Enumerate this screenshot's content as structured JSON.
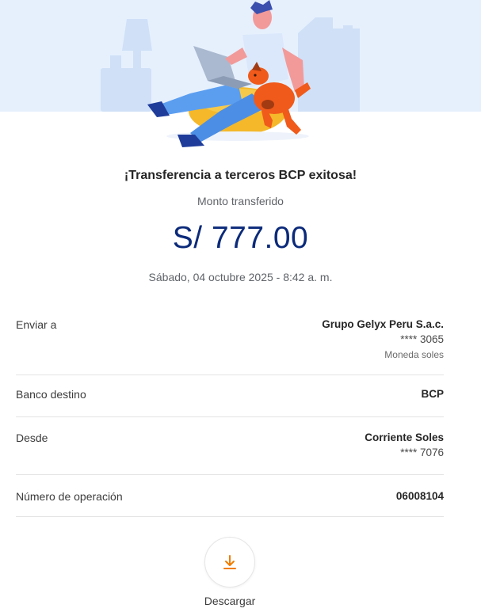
{
  "header": {
    "title": "¡Transferencia a terceros BCP exitosa!",
    "subtitle": "Monto transferido",
    "amount": "S/ 777.00",
    "date": "Sábado, 04 octubre 2025 - 8:42 a. m."
  },
  "details": {
    "recipient": {
      "label": "Enviar a",
      "name": "Grupo Gelyx Peru S.a.c.",
      "account": "**** 3065",
      "currency": "Moneda soles"
    },
    "bank": {
      "label": "Banco destino",
      "value": "BCP"
    },
    "source": {
      "label": "Desde",
      "account_type": "Corriente Soles",
      "account": "**** 7076"
    },
    "operation": {
      "label": "Número de operación",
      "value": "06008104"
    }
  },
  "actions": {
    "download_label": "Descargar",
    "download_icon": "download-icon"
  },
  "colors": {
    "amount": "#0b2a7a",
    "accent": "#f07c00",
    "hero_bg": "#e6f0fd"
  }
}
